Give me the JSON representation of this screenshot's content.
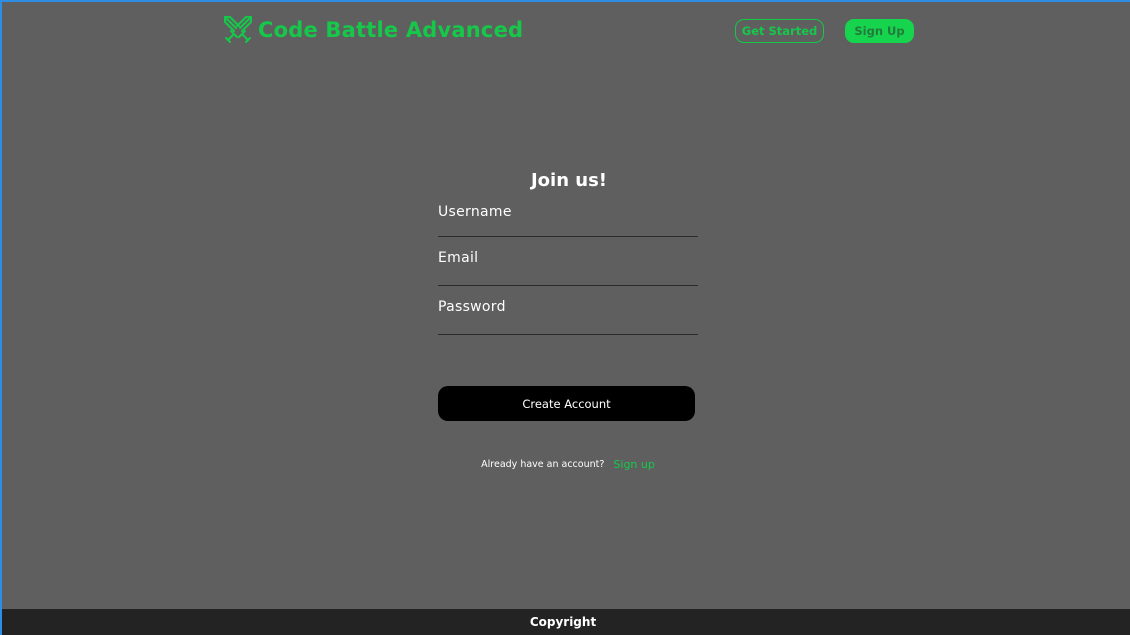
{
  "header": {
    "brand": "Code Battle Advanced",
    "logo_icon": "crossed-swords-icon",
    "get_started_label": "Get Started",
    "signup_label": "Sign Up"
  },
  "form": {
    "title": "Join us!",
    "username_label": "Username",
    "email_label": "Email",
    "password_label": "Password",
    "submit_label": "Create Account",
    "already_text": "Already have an account?",
    "signin_link": "Sign up"
  },
  "footer": {
    "text": "Copyright"
  },
  "colors": {
    "accent": "#16c84a",
    "background": "#5f5f5f",
    "footer_bg": "#232323",
    "button_bg": "#000000"
  }
}
